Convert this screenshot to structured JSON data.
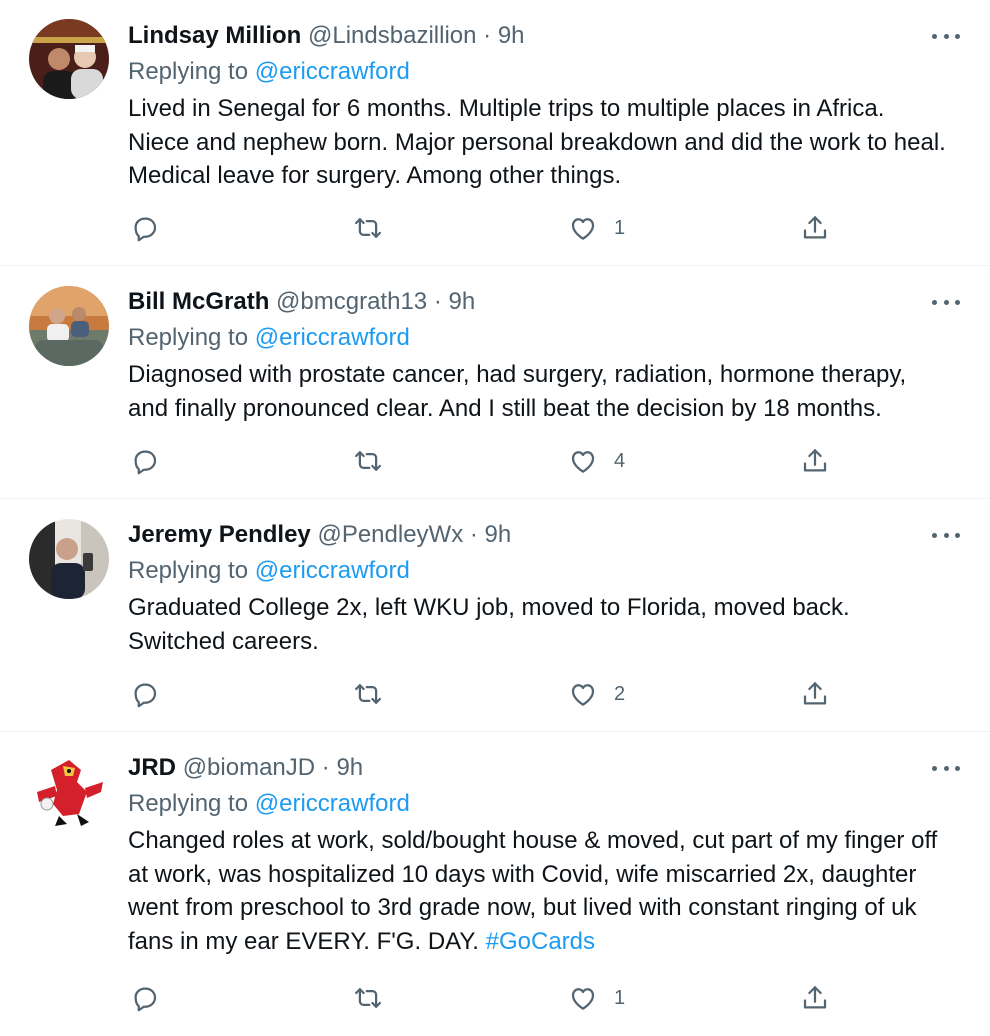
{
  "tweets": [
    {
      "name": "Lindsay Million",
      "handle": "@Lindsbazillion",
      "dot": "·",
      "time": "9h",
      "replying_prefix": "Replying to ",
      "replying_to": "@ericcrawford",
      "text": "Lived in Senegal for 6 months. Multiple trips to multiple places in Africa. Niece and nephew born. Major personal breakdown and did the work to heal. Medical leave for surgery. Among other things.",
      "likes": "1"
    },
    {
      "name": "Bill McGrath",
      "handle": "@bmcgrath13",
      "dot": "·",
      "time": "9h",
      "replying_prefix": "Replying to ",
      "replying_to": "@ericcrawford",
      "text": "Diagnosed with prostate cancer, had surgery, radiation, hormone therapy, and finally pronounced clear.  And I still beat the decision by 18 months.",
      "likes": "4"
    },
    {
      "name": "Jeremy Pendley",
      "handle": "@PendleyWx",
      "dot": "·",
      "time": "9h",
      "replying_prefix": "Replying to ",
      "replying_to": "@ericcrawford",
      "text": "Graduated College 2x, left WKU job, moved to Florida, moved back. Switched careers.",
      "likes": "2"
    },
    {
      "name": "JRD",
      "handle": "@biomanJD",
      "dot": "·",
      "time": "9h",
      "replying_prefix": "Replying to ",
      "replying_to": "@ericcrawford",
      "text": "Changed roles at work, sold/bought house & moved, cut part of my finger off at work, was hospitalized 10 days with Covid, wife miscarried 2x, daughter went from preschool to 3rd grade now, but lived with constant ringing of uk fans in my ear EVERY. F'G. DAY. ",
      "hashtag": "#GoCards",
      "likes": "1"
    }
  ],
  "icons": {
    "reply": "reply-icon",
    "retweet": "retweet-icon",
    "like": "heart-icon",
    "share": "share-icon",
    "more": "more-options-icon"
  },
  "colors": {
    "link": "#1d9bf0",
    "secondary": "#536471",
    "divider": "#eff3f4"
  }
}
